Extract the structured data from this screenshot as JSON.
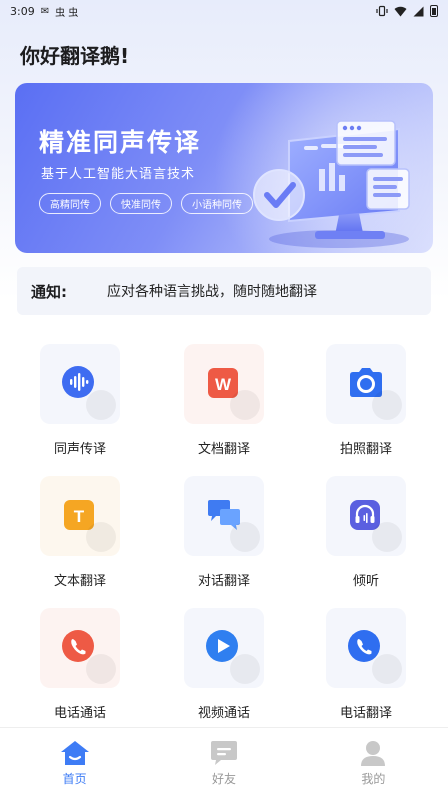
{
  "status_bar": {
    "time": "3:09",
    "notif_a": "✉",
    "notif_b": "虫 虫"
  },
  "greeting": "你好翻译鹅!",
  "banner": {
    "title": "精准同声传译",
    "subtitle": "基于人工智能大语言技术",
    "chips": [
      "高精同传",
      "快准同传",
      "小语种同传"
    ]
  },
  "notice": {
    "label": "通知:",
    "text": "应对各种语言挑战，随时随地翻译"
  },
  "features": [
    {
      "label": "同声传译",
      "icon": "voice-wave-icon",
      "bg": "#f4f6fc",
      "color": "#3e6cf1"
    },
    {
      "label": "文档翻译",
      "icon": "word-doc-icon",
      "bg": "#fdf3f1",
      "color": "#ee5a45"
    },
    {
      "label": "拍照翻译",
      "icon": "camera-icon",
      "bg": "#f4f6fc",
      "color": "#2f6ef0"
    },
    {
      "label": "文本翻译",
      "icon": "text-t-icon",
      "bg": "#fdf7ee",
      "color": "#f5a623"
    },
    {
      "label": "对话翻译",
      "icon": "chat-bubbles-icon",
      "bg": "#f4f6fc",
      "color": "#3f7bf2"
    },
    {
      "label": "倾听",
      "icon": "headphones-icon",
      "bg": "#f4f6fc",
      "color": "#5a5fe0"
    },
    {
      "label": "电话通话",
      "icon": "phone-call-icon",
      "bg": "#fdf3f1",
      "color": "#ee5a45"
    },
    {
      "label": "视频通话",
      "icon": "video-play-icon",
      "bg": "#f4f6fc",
      "color": "#2f7ff0"
    },
    {
      "label": "电话翻译",
      "icon": "phone-translate-icon",
      "bg": "#f4f6fc",
      "color": "#2f6ef0"
    }
  ],
  "tabs": [
    {
      "label": "首页",
      "icon": "home-icon",
      "active": true
    },
    {
      "label": "好友",
      "icon": "chat-icon",
      "active": false
    },
    {
      "label": "我的",
      "icon": "profile-icon",
      "active": false
    }
  ]
}
